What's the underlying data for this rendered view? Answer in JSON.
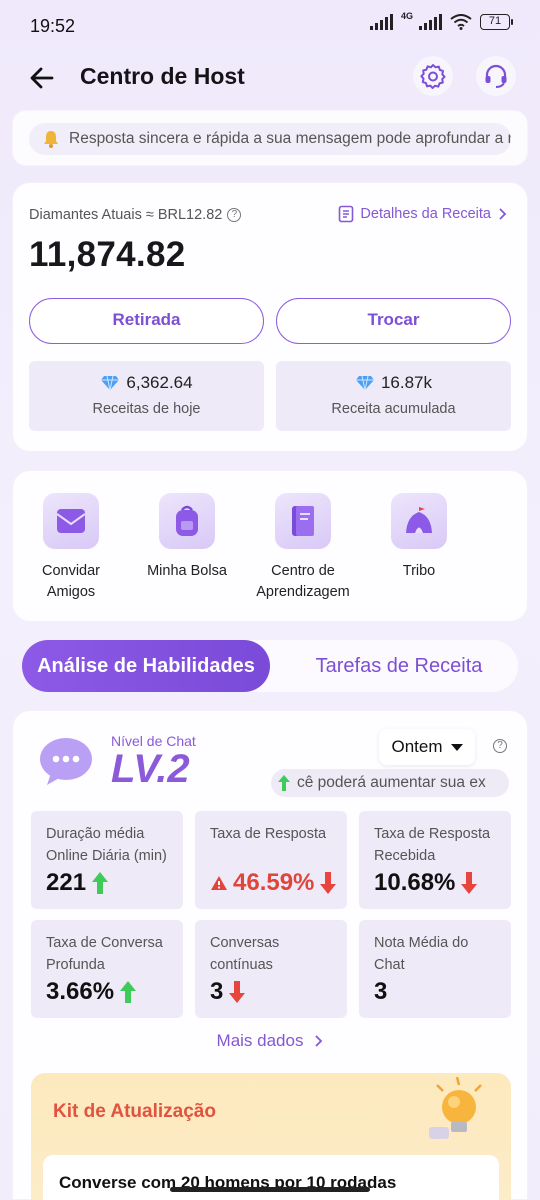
{
  "status_bar": {
    "time": "19:52",
    "network": "4G",
    "battery": "71"
  },
  "header": {
    "title": "Centro de Host"
  },
  "notice": {
    "text": "Resposta sincera e rápida a sua mensagem pode aprofundar a rela"
  },
  "earnings": {
    "label": "Diamantes Atuais ≈ BRL12.82",
    "details_link": "Detalhes da Receita",
    "amount": "11,874.82",
    "withdraw_label": "Retirada",
    "exchange_label": "Trocar",
    "today": {
      "value": "6,362.64",
      "label": "Receitas de hoje"
    },
    "total": {
      "value": "16.87k",
      "label": "Receita acumulada"
    }
  },
  "tools": [
    {
      "line1": "Convidar",
      "line2": "Amigos"
    },
    {
      "line1": "Minha Bolsa",
      "line2": ""
    },
    {
      "line1": "Centro de",
      "line2": "Aprendizagem"
    },
    {
      "line1": "Tribo",
      "line2": ""
    }
  ],
  "tabs": {
    "active": "Análise de Habilidades",
    "inactive": "Tarefas de Receita"
  },
  "skills": {
    "level_label": "Nível de Chat",
    "level_value": "LV.2",
    "date_filter": "Ontem",
    "hint": "cê poderá aumentar sua ex",
    "metrics": [
      {
        "line1": "Duração média",
        "line2": "Online Diária (min)",
        "value": "221",
        "trend": "up",
        "alert": false
      },
      {
        "line1": "Taxa de Resposta",
        "line2": "",
        "value": "46.59%",
        "trend": "down",
        "alert": true
      },
      {
        "line1": "Taxa de Resposta",
        "line2": "Recebida",
        "value": "10.68%",
        "trend": "down",
        "alert": false
      },
      {
        "line1": "Taxa de Conversa",
        "line2": "Profunda",
        "value": "3.66%",
        "trend": "up",
        "alert": false
      },
      {
        "line1": "Conversas",
        "line2": "contínuas",
        "value": "3",
        "trend": "down",
        "alert": false
      },
      {
        "line1": "Nota Média do",
        "line2": "Chat",
        "value": "3",
        "trend": "none",
        "alert": false
      }
    ],
    "more_data": "Mais dados"
  },
  "kit": {
    "title": "Kit de Atualização",
    "task": "Converse com 20 homens por 10 rodadas"
  },
  "colors": {
    "accent": "#8b5de0",
    "alert": "#e0453c",
    "up": "#3ecb5a",
    "down": "#e8453c"
  }
}
